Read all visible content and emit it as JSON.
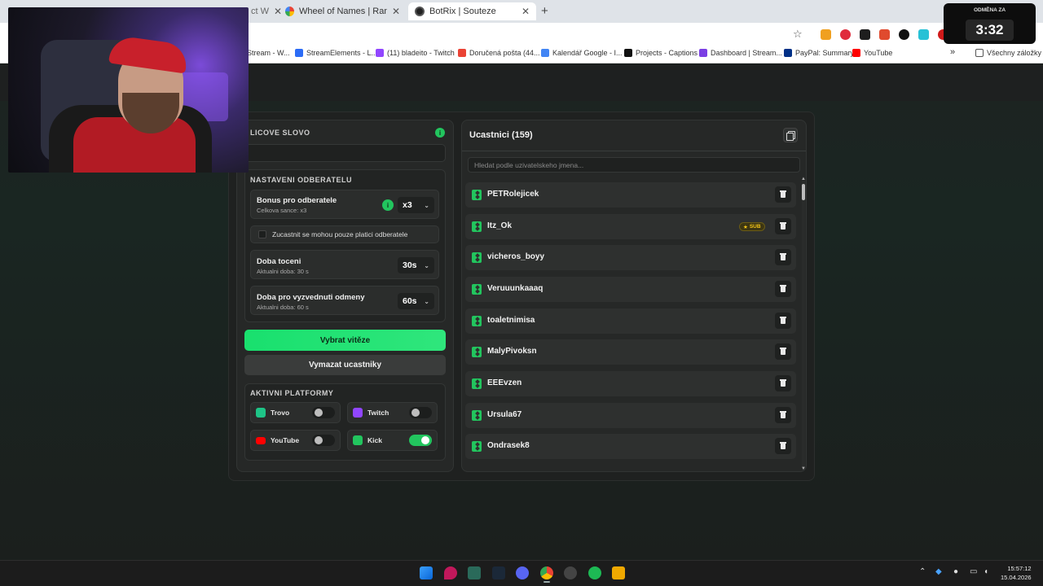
{
  "browser": {
    "tabs": [
      {
        "title": "Wheel of Names | Random nam",
        "active": false
      },
      {
        "title": "BotRix | Souteze",
        "active": true
      }
    ],
    "partial_tab_fragment": "ct W",
    "new_tab": "+",
    "bookmarks": [
      {
        "label": "Stream - W..."
      },
      {
        "label": "StreamElements - L..."
      },
      {
        "label": "(11) bladeito - Twitch"
      },
      {
        "label": "Doručená pošta (44..."
      },
      {
        "label": "Kalendář Google - I..."
      },
      {
        "label": "Projects - Captions"
      },
      {
        "label": "Dashboard | Stream..."
      },
      {
        "label": "PayPal: Summary"
      },
      {
        "label": "YouTube"
      }
    ],
    "bookmarks_more": "»",
    "all_bookmarks": "Všechny záložky"
  },
  "timer": {
    "label": "ODMĚNA ZA",
    "value": "3:32"
  },
  "left_panel": {
    "keyword_title": "LICOVE SLOVO",
    "keyword_info": "i",
    "sub_settings_title": "NASTAVENI ODBERATELU",
    "bonus": {
      "title": "Bonus pro odberatele",
      "subtitle": "Celkova sance: x3",
      "info": "i",
      "value": "x3"
    },
    "subs_only_label": "Zucastnit se mohou pouze platici odberatele",
    "spin_duration": {
      "title": "Doba toceni",
      "subtitle": "Aktualni doba: 30 s",
      "value": "30s"
    },
    "claim_time": {
      "title": "Doba pro vyzvednuti odmeny",
      "subtitle": "Aktualni doba: 60 s",
      "value": "60s"
    },
    "pick_winner_button": "Vybrat vitěze",
    "clear_participants_button": "Vymazat ucastniky",
    "platforms_title": "AKTIVNI PLATFORMY",
    "platforms": [
      {
        "name": "Trovo",
        "enabled": false,
        "color": "#1ec487"
      },
      {
        "name": "Twitch",
        "enabled": false,
        "color": "#9146ff"
      },
      {
        "name": "YouTube",
        "enabled": false,
        "color": "#ff0000"
      },
      {
        "name": "Kick",
        "enabled": true,
        "color": "#53fc18"
      }
    ]
  },
  "right_panel": {
    "title": "Ucastnici (159)",
    "search_placeholder": "Hledat podle uzivatelskeho jmena...",
    "participants": [
      {
        "name": "PETRolejicek",
        "sub": false
      },
      {
        "name": "Itz_Ok",
        "sub": true
      },
      {
        "name": "vicheros_boyy",
        "sub": false
      },
      {
        "name": "Veruuunkaaaq",
        "sub": false
      },
      {
        "name": "toaletnimisa",
        "sub": false
      },
      {
        "name": "MalyPivoksn",
        "sub": false
      },
      {
        "name": "EEEvzen",
        "sub": false
      },
      {
        "name": "Ursula67",
        "sub": false
      },
      {
        "name": "Ondrasek8",
        "sub": false
      }
    ],
    "sub_badge": "SUB"
  },
  "taskbar": {
    "time": "15:57:12",
    "date": "15.04.2026"
  },
  "colors": {
    "accent": "#22c55e",
    "panel": "#262827",
    "background": "#1b1e1d"
  }
}
